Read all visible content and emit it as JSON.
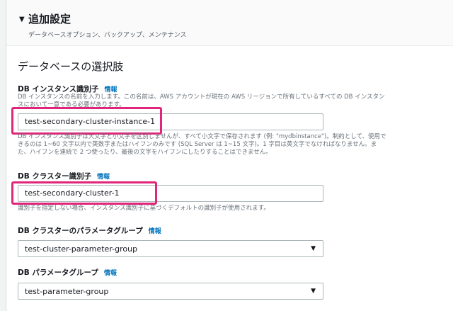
{
  "header": {
    "title": "追加設定",
    "subtitle": "データベースオプション、バックアップ、メンテナンス"
  },
  "section": {
    "title": "データベースの選択肢"
  },
  "instance_identifier": {
    "label": "DB インスタンス識別子",
    "info": "情報",
    "description_1": "DB インスタンスの名前を入力します。この名前は、AWS アカウントが現在の AWS リージョンで所有しているすべての DB インスタン",
    "description_2": "スにおいて一意である必要があります。",
    "value": "test-secondary-cluster-instance-1",
    "hint_1": "DB インスタンス識別子は大文字と小文字を区別しませんが、すべて小文字で保存されます (例: \"mydbinstance\")。制約として、使用で",
    "hint_2": "きるのは 1~60 文字以内で英数字またはハイフンのみです (SQL Server は 1~15 文字)。1 字目は英文字でなければなりません。ま",
    "hint_3": "た、ハイフンを連続で 2 つ使ったり、最後の文字をハイフンにしたりすることはできません。"
  },
  "cluster_identifier": {
    "label": "DB クラスター識別子",
    "info": "情報",
    "value": "test-secondary-cluster-1",
    "hint": "識別子を指定しない場合、インスタンス識別子に基づくデフォルトの識別子が使用されます。"
  },
  "cluster_parameter_group": {
    "label": "DB クラスターのパラメータグループ",
    "info": "情報",
    "selected": "test-cluster-parameter-group"
  },
  "parameter_group": {
    "label": "DB パラメータグループ",
    "info": "情報",
    "selected": "test-parameter-group"
  },
  "colors": {
    "highlight": "#e0257a",
    "link": "#0073bb"
  }
}
